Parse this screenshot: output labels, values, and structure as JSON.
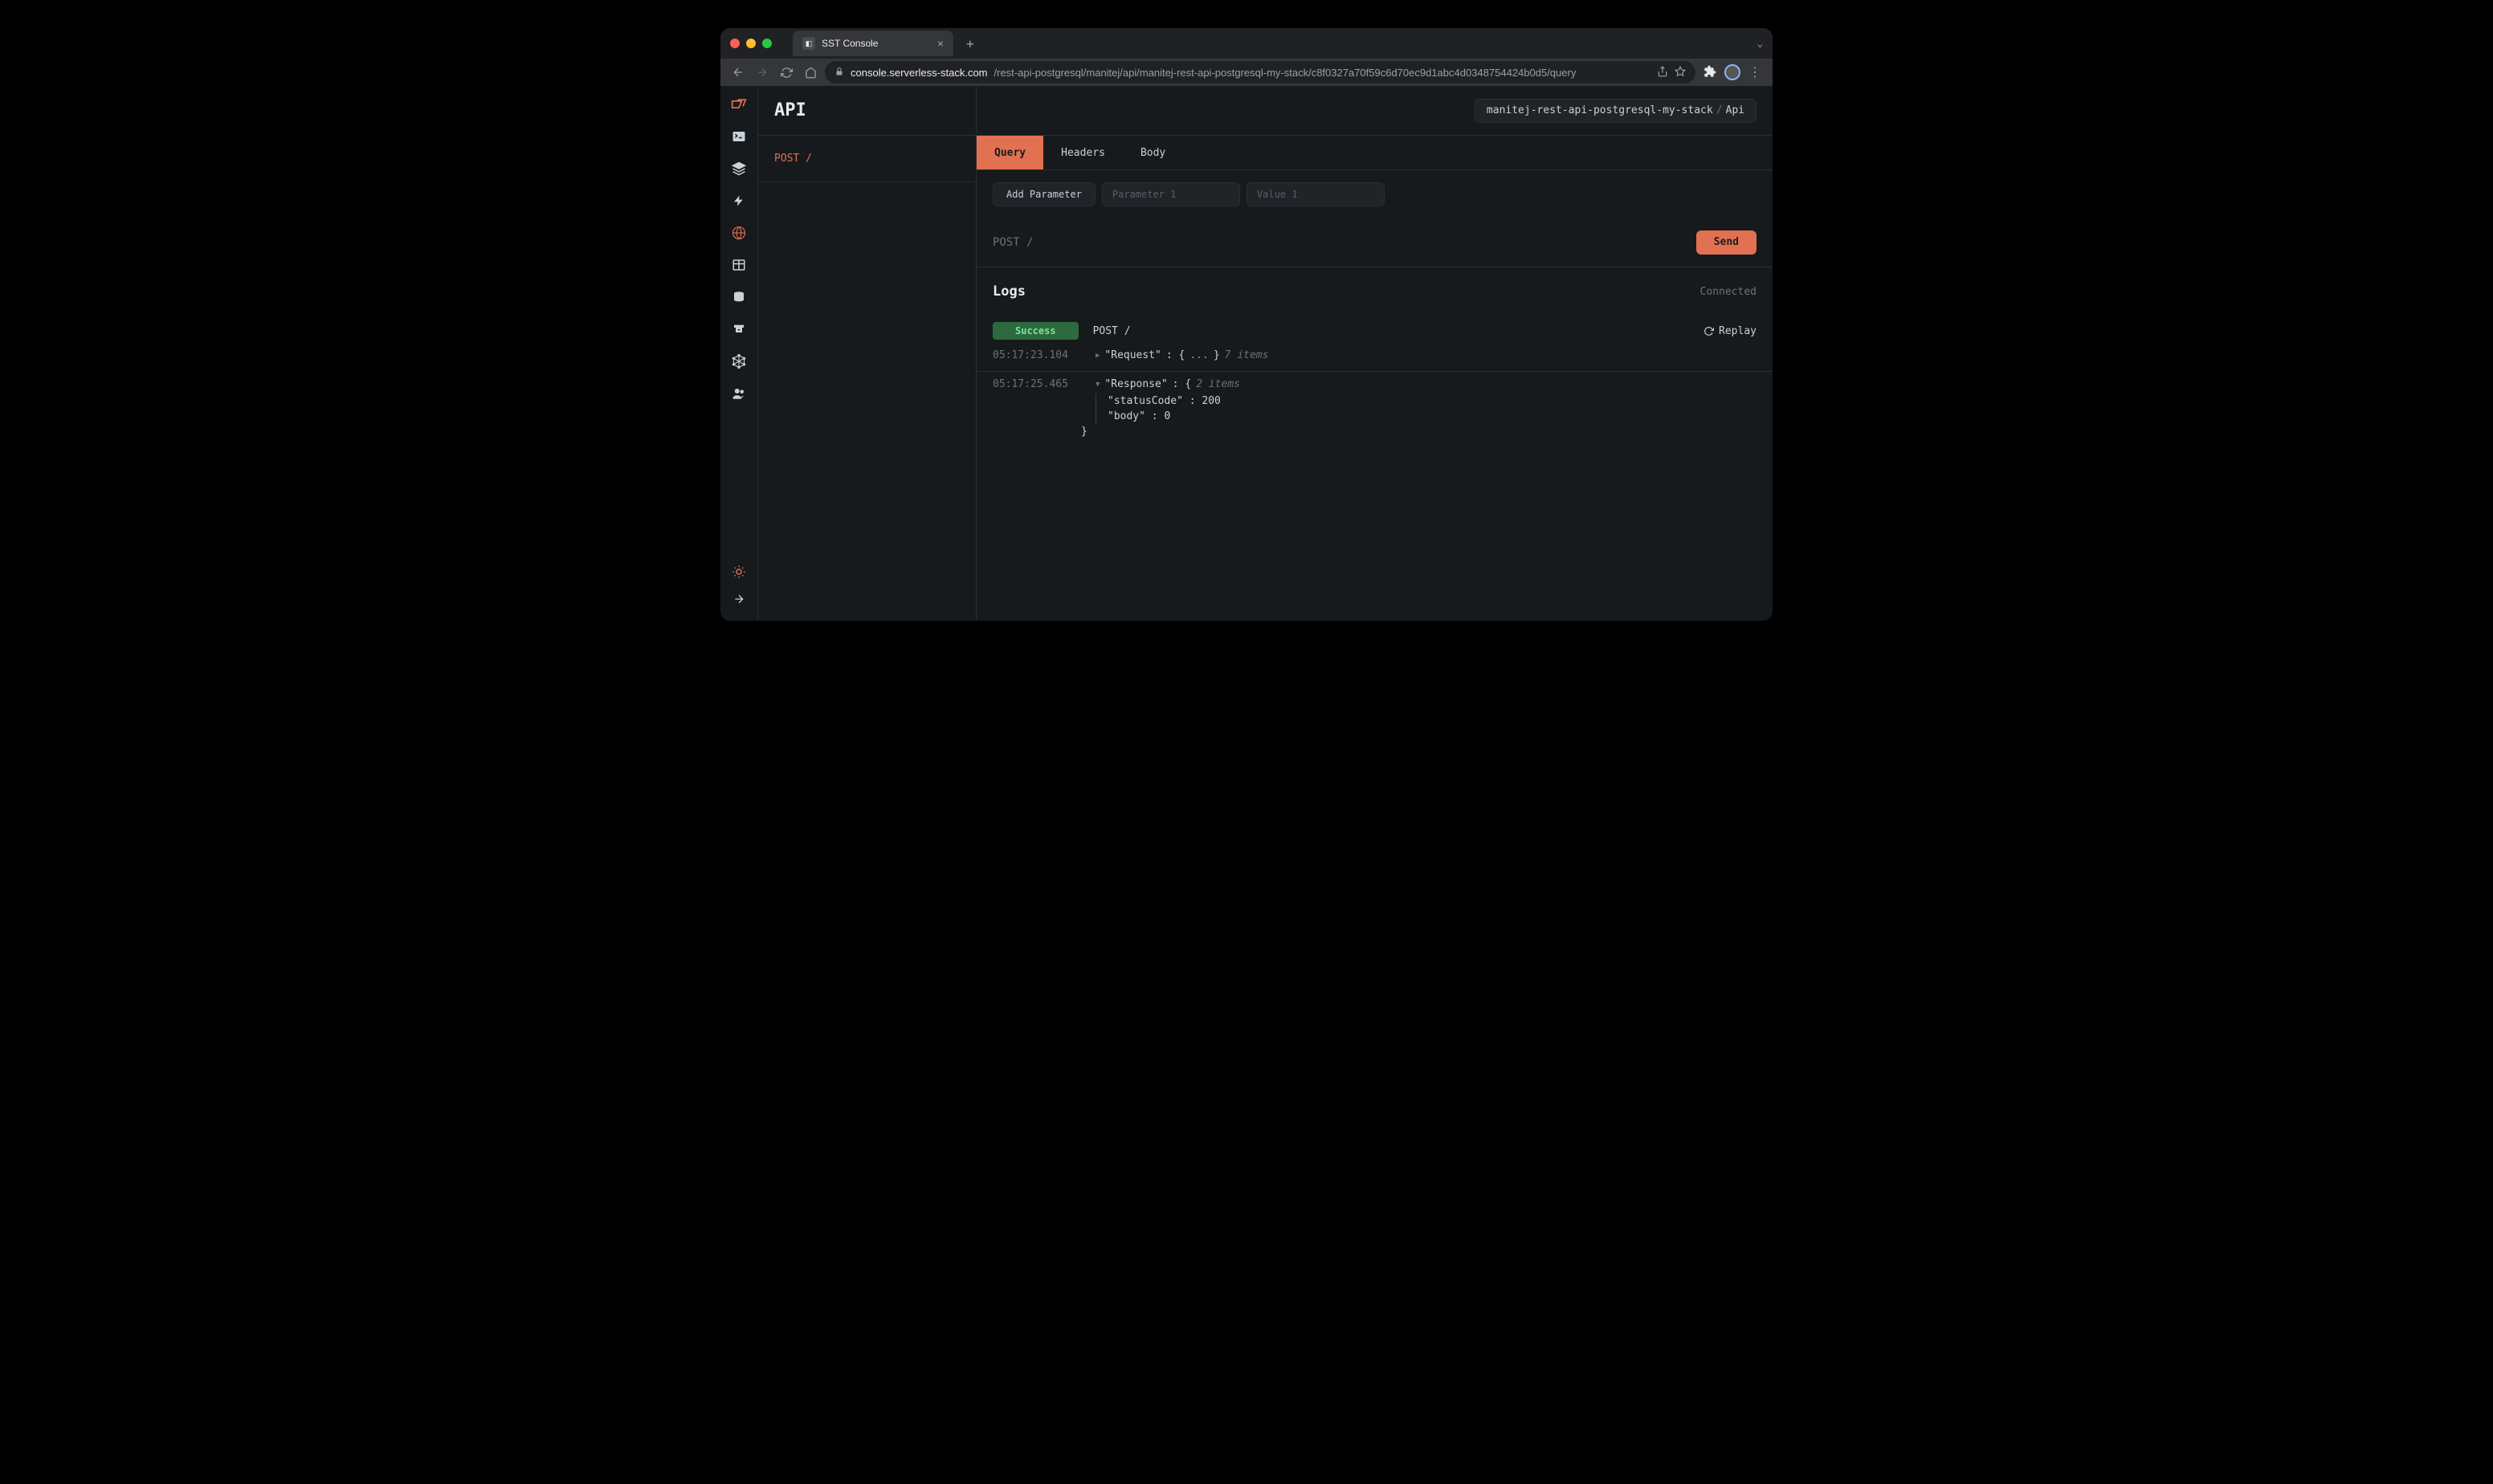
{
  "browser": {
    "tab_title": "SST Console",
    "new_tab_glyph": "+",
    "url_host": "console.serverless-stack.com",
    "url_path": "/rest-api-postgresql/manitej/api/manitej-rest-api-postgresql-my-stack/c8f0327a70f59c6d70ec9d1abc4d0348754424b0d5/query"
  },
  "header": {
    "title": "API",
    "breadcrumb_stack": "manitej-rest-api-postgresql-my-stack",
    "breadcrumb_resource": "Api"
  },
  "route": "POST /",
  "tabs": {
    "query": "Query",
    "headers": "Headers",
    "body": "Body"
  },
  "toolbar": {
    "add_param": "Add Parameter",
    "param_name_ph": "Parameter 1",
    "param_val_ph": "Value 1"
  },
  "send": {
    "method_path": "POST /",
    "button": "Send"
  },
  "logs": {
    "title": "Logs",
    "status": "Connected",
    "success": "Success",
    "result_path": "POST /",
    "replay": "Replay",
    "req": {
      "ts": "05:17:23.104",
      "key": "\"Request\"",
      "items": "7 items"
    },
    "res": {
      "ts": "05:17:25.465",
      "key": "\"Response\"",
      "items": "2 items",
      "status_key": "\"statusCode\"",
      "status_val": "200",
      "body_key": "\"body\"",
      "body_val": "0"
    }
  }
}
